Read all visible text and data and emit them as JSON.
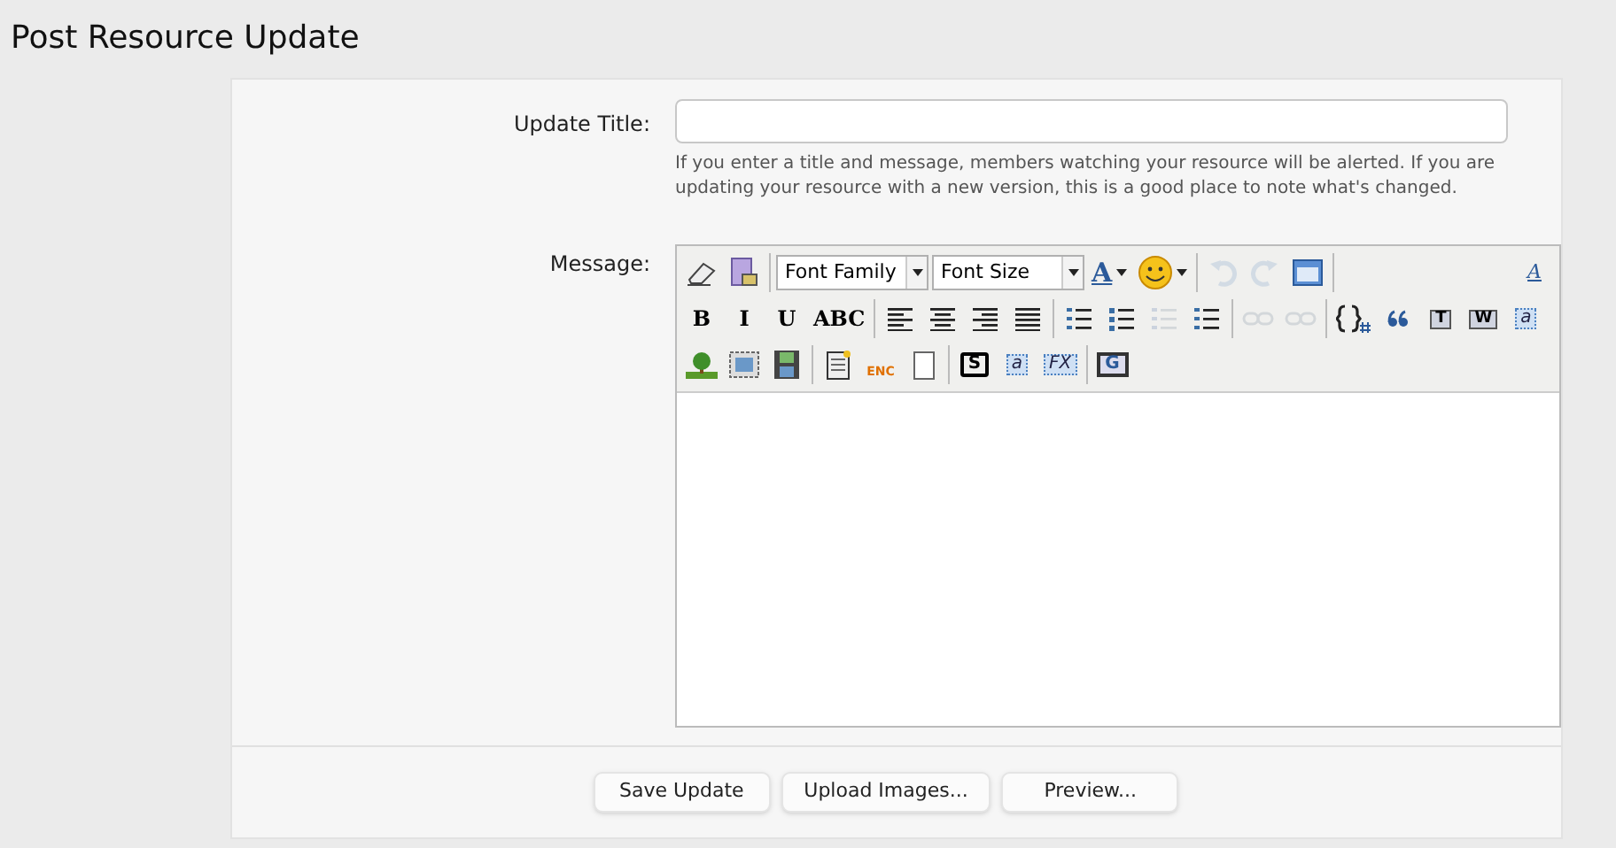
{
  "page_title": "Post Resource Update",
  "form": {
    "title_label": "Update Title:",
    "title_hint": "If you enter a title and message, members watching your resource will be alerted. If you are updating your resource with a new version, this is a good place to note what's changed.",
    "message_label": "Message:"
  },
  "toolbar_rows": [
    [
      [
        {
          "kind": "eraser",
          "disabled": false
        },
        {
          "kind": "paste-doc",
          "disabled": false
        }
      ],
      [
        {
          "kind": "select",
          "label": "Font Family",
          "disabled": false
        },
        {
          "kind": "select",
          "label": "Font Size",
          "disabled": false
        },
        {
          "kind": "color",
          "label": "A",
          "disabled": false
        },
        {
          "kind": "smiley",
          "disabled": false
        }
      ],
      [
        {
          "kind": "undo",
          "disabled": true
        },
        {
          "kind": "redo",
          "disabled": true
        },
        {
          "kind": "window",
          "disabled": false
        }
      ],
      [
        {
          "kind": "font-size",
          "label": "A",
          "disabled": false
        }
      ]
    ],
    [
      [
        {
          "kind": "text",
          "label": "B",
          "disabled": false
        },
        {
          "kind": "text",
          "label": "I",
          "disabled": false
        },
        {
          "kind": "text",
          "label": "U",
          "disabled": false
        },
        {
          "kind": "text",
          "label": "ABC",
          "disabled": false
        }
      ],
      [
        {
          "kind": "align-left",
          "disabled": false
        },
        {
          "kind": "align-center",
          "disabled": false
        },
        {
          "kind": "align-right",
          "disabled": false
        },
        {
          "kind": "justify",
          "disabled": false
        }
      ],
      [
        {
          "kind": "bullets",
          "disabled": false
        },
        {
          "kind": "numbers",
          "disabled": false
        },
        {
          "kind": "outdent",
          "disabled": true
        },
        {
          "kind": "indent",
          "disabled": false
        }
      ],
      [
        {
          "kind": "link",
          "disabled": true
        },
        {
          "kind": "unlink",
          "disabled": true
        }
      ],
      [
        {
          "kind": "code",
          "disabled": false
        },
        {
          "kind": "quote",
          "disabled": false
        },
        {
          "kind": "paste",
          "label": "T",
          "disabled": false
        },
        {
          "kind": "paste",
          "label": "W",
          "disabled": false
        },
        {
          "kind": "tile",
          "label": "a",
          "disabled": false
        }
      ]
    ],
    [
      [
        {
          "kind": "image",
          "disabled": false
        },
        {
          "kind": "media",
          "disabled": false
        },
        {
          "kind": "film",
          "disabled": false
        }
      ],
      [
        {
          "kind": "page",
          "disabled": false
        },
        {
          "kind": "enc",
          "label": "ENC",
          "disabled": false
        },
        {
          "kind": "blank",
          "disabled": false
        }
      ],
      [
        {
          "kind": "speech",
          "label": "S",
          "disabled": false
        },
        {
          "kind": "tile",
          "label": "a",
          "disabled": false
        },
        {
          "kind": "tile",
          "label": "FX",
          "disabled": false
        }
      ],
      [
        {
          "kind": "monitor",
          "label": "G",
          "disabled": false
        }
      ]
    ]
  ],
  "buttons": [
    {
      "label": "Save Update"
    },
    {
      "label": "Upload Images..."
    },
    {
      "label": "Preview..."
    }
  ]
}
